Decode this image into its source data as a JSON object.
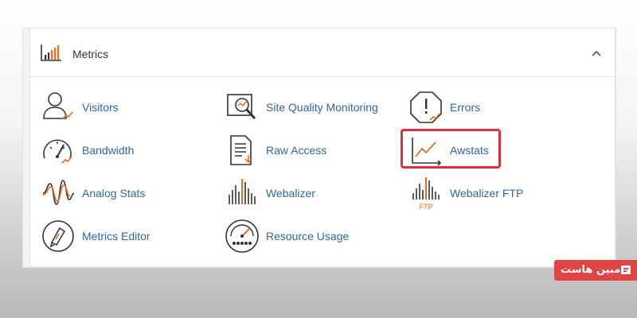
{
  "section": {
    "title": "Metrics",
    "header_icon": "bar-chart-icon",
    "collapse_icon": "chevron-up-icon"
  },
  "items": [
    {
      "label": "Visitors",
      "icon": "visitors-icon"
    },
    {
      "label": "Site Quality Monitoring",
      "icon": "site-quality-icon"
    },
    {
      "label": "Errors",
      "icon": "errors-icon"
    },
    {
      "label": "Bandwidth",
      "icon": "bandwidth-icon"
    },
    {
      "label": "Raw Access",
      "icon": "raw-access-icon"
    },
    {
      "label": "Awstats",
      "icon": "awstats-icon",
      "highlighted": true
    },
    {
      "label": "Analog Stats",
      "icon": "analog-stats-icon"
    },
    {
      "label": "Webalizer",
      "icon": "webalizer-icon"
    },
    {
      "label": "Webalizer FTP",
      "icon": "webalizer-ftp-icon",
      "icon_text": "FTP"
    },
    {
      "label": "Metrics Editor",
      "icon": "metrics-editor-icon"
    },
    {
      "label": "Resource Usage",
      "icon": "resource-usage-icon"
    }
  ],
  "watermark": {
    "text": "مبین هاست",
    "icon": "logo-icon"
  },
  "colors": {
    "link": "#2f65a6",
    "icon_dark": "#333333",
    "icon_accent": "#f26b21",
    "highlight": "#d9313e",
    "brand_bg": "#e04444"
  }
}
